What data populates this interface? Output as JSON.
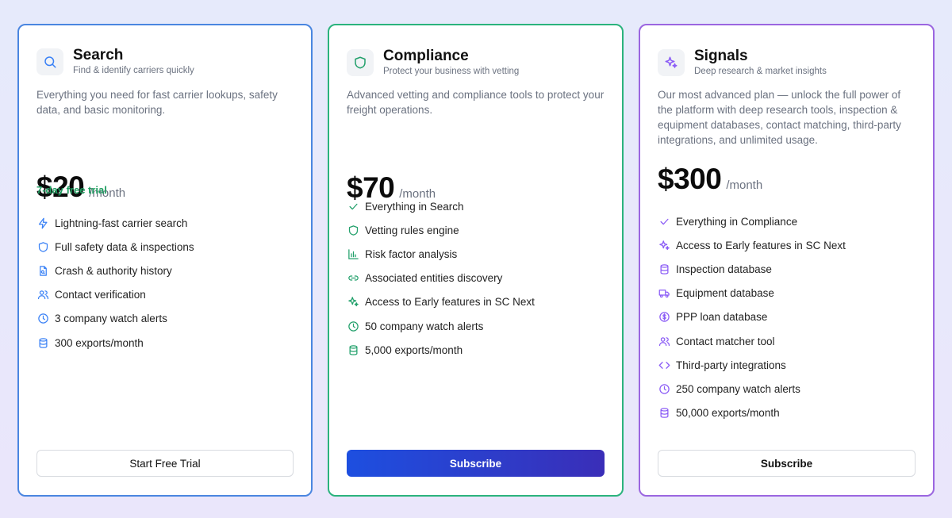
{
  "plans": {
    "search": {
      "title": "Search",
      "subtitle": "Find & identify carriers quickly",
      "icon": "search-icon",
      "accent": "#4a86e0",
      "description": "Everything you need for fast carrier lookups, safety data, and basic monitoring.",
      "price": "$20",
      "period": "/month",
      "trial": "7-day free trial",
      "features": [
        {
          "icon": "lightning-icon",
          "label": "Lightning-fast carrier search"
        },
        {
          "icon": "shield-icon",
          "label": "Full safety data & inspections"
        },
        {
          "icon": "document-search-icon",
          "label": "Crash & authority history"
        },
        {
          "icon": "users-icon",
          "label": "Contact verification"
        },
        {
          "icon": "clock-icon",
          "label": "3 company watch alerts"
        },
        {
          "icon": "database-icon",
          "label": "300 exports/month"
        }
      ],
      "button": "Start Free Trial"
    },
    "compliance": {
      "title": "Compliance",
      "subtitle": "Protect your business with vetting",
      "icon": "shield-icon",
      "accent": "#2bb37d",
      "description": "Advanced vetting and compliance tools to protect your freight operations.",
      "price": "$70",
      "period": "/month",
      "features": [
        {
          "icon": "check-icon",
          "label": "Everything in Search"
        },
        {
          "icon": "shield-icon",
          "label": "Vetting rules engine"
        },
        {
          "icon": "bar-chart-icon",
          "label": "Risk factor analysis"
        },
        {
          "icon": "link-icon",
          "label": "Associated entities discovery"
        },
        {
          "icon": "sparkles-icon",
          "label": "Access to Early features in SC Next"
        },
        {
          "icon": "clock-icon",
          "label": "50 company watch alerts"
        },
        {
          "icon": "database-icon",
          "label": "5,000 exports/month"
        }
      ],
      "button": "Subscribe"
    },
    "signals": {
      "title": "Signals",
      "subtitle": "Deep research & market insights",
      "icon": "sparkles-icon",
      "accent": "#9b66e0",
      "description": "Our most advanced plan — unlock the full power of the platform with deep research tools, inspection & equipment databases, contact matching, third-party integrations, and unlimited usage.",
      "price": "$300",
      "period": "/month",
      "features": [
        {
          "icon": "check-icon",
          "label": "Everything in Compliance"
        },
        {
          "icon": "sparkles-icon",
          "label": "Access to Early features in SC Next"
        },
        {
          "icon": "database-icon",
          "label": "Inspection database"
        },
        {
          "icon": "truck-icon",
          "label": "Equipment database"
        },
        {
          "icon": "dollar-icon",
          "label": "PPP loan database"
        },
        {
          "icon": "users-icon",
          "label": "Contact matcher tool"
        },
        {
          "icon": "code-icon",
          "label": "Third-party integrations"
        },
        {
          "icon": "clock-icon",
          "label": "250 company watch alerts"
        },
        {
          "icon": "database-icon",
          "label": "50,000 exports/month"
        }
      ],
      "button": "Subscribe"
    }
  }
}
